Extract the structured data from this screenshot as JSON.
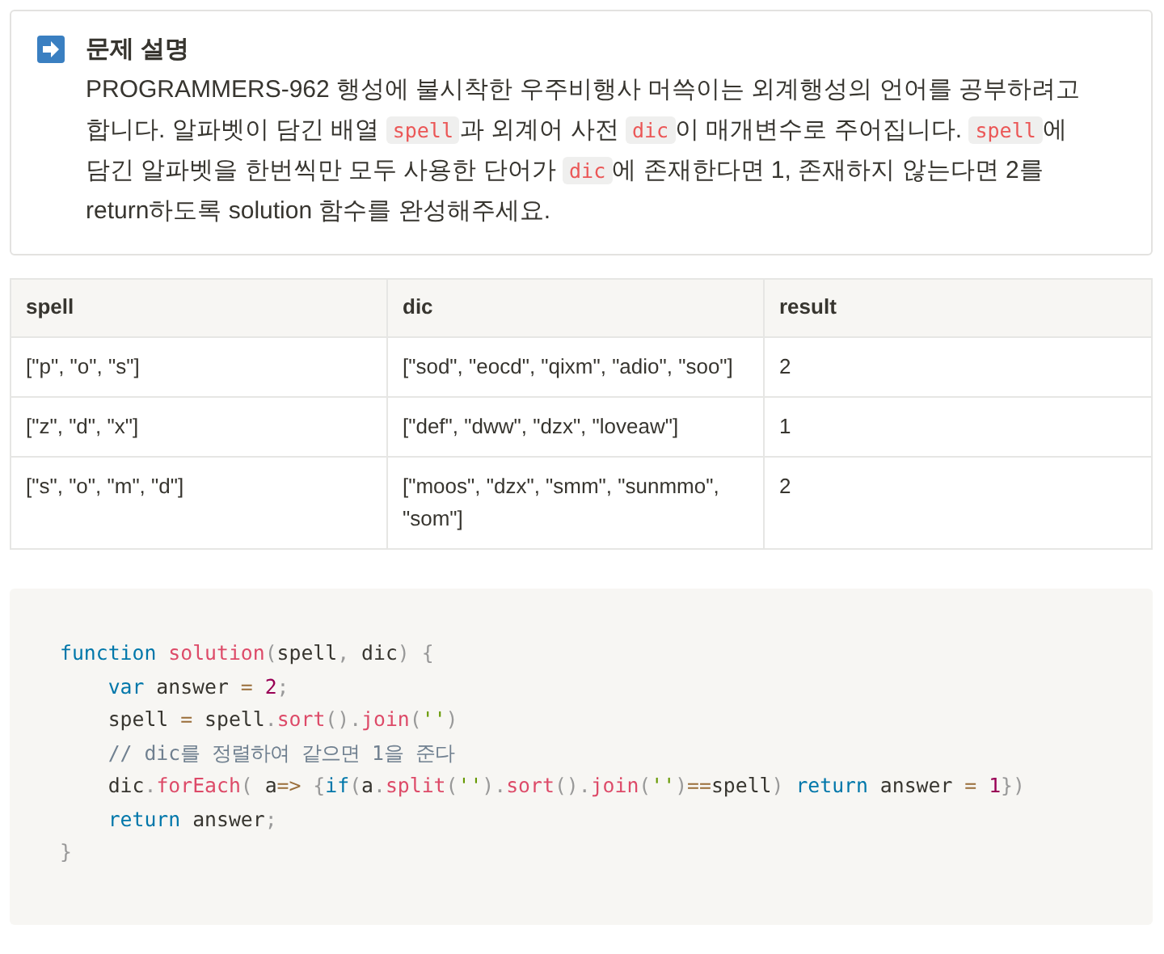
{
  "callout": {
    "title": "문제 설명",
    "paragraph": [
      {
        "kind": "text",
        "text": "PROGRAMMERS-962 행성에 불시착한 우주비행사 머쓱이는 외계행성의 언어를 공부하려고 합니다. 알파벳이 담긴 배열 "
      },
      {
        "kind": "code",
        "text": "spell"
      },
      {
        "kind": "text",
        "text": "과 외계어 사전 "
      },
      {
        "kind": "code",
        "text": "dic"
      },
      {
        "kind": "text",
        "text": "이 매개변수로 주어집니다. "
      },
      {
        "kind": "code",
        "text": "spell"
      },
      {
        "kind": "text",
        "text": "에 담긴 알파벳을 한번씩만 모두 사용한 단어가 "
      },
      {
        "kind": "code",
        "text": "dic"
      },
      {
        "kind": "text",
        "text": "에 존재한다면 1, 존재하지 않는다면 2를 return하도록 solution 함수를 완성해주세요."
      }
    ]
  },
  "table": {
    "columns": [
      "spell",
      "dic",
      "result"
    ],
    "rows": [
      [
        "[\"p\", \"o\", \"s\"]",
        "[\"sod\", \"eocd\", \"qixm\", \"adio\", \"soo\"]",
        "2"
      ],
      [
        "[\"z\", \"d\", \"x\"]",
        "[\"def\", \"dww\", \"dzx\", \"loveaw\"]",
        "1"
      ],
      [
        "[\"s\", \"o\", \"m\", \"d\"]",
        "[\"moos\", \"dzx\", \"smm\", \"sunmmo\", \"som\"]",
        "2"
      ]
    ]
  },
  "code": [
    [
      {
        "kind": "keyword",
        "text": "function"
      },
      {
        "kind": "function",
        "text": " solution"
      },
      {
        "kind": "punct",
        "text": "("
      },
      {
        "kind": "plain",
        "text": "spell"
      },
      {
        "kind": "punct",
        "text": ","
      },
      {
        "kind": "plain",
        "text": " dic"
      },
      {
        "kind": "punct",
        "text": ") {"
      }
    ],
    [
      {
        "kind": "keyword",
        "text": "    var"
      },
      {
        "kind": "plain",
        "text": " answer "
      },
      {
        "kind": "operator",
        "text": "="
      },
      {
        "kind": "number",
        "text": " 2"
      },
      {
        "kind": "punct",
        "text": ";"
      }
    ],
    [
      {
        "kind": "plain",
        "text": "    spell "
      },
      {
        "kind": "operator",
        "text": "="
      },
      {
        "kind": "plain",
        "text": " spell"
      },
      {
        "kind": "punct",
        "text": "."
      },
      {
        "kind": "function",
        "text": "sort"
      },
      {
        "kind": "punct",
        "text": "()."
      },
      {
        "kind": "function",
        "text": "join"
      },
      {
        "kind": "punct",
        "text": "("
      },
      {
        "kind": "string",
        "text": "''"
      },
      {
        "kind": "punct",
        "text": ")"
      }
    ],
    [
      {
        "kind": "comment",
        "text": "    // dic를 정렬하여 같으면 1을 준다"
      }
    ],
    [
      {
        "kind": "plain",
        "text": "    dic"
      },
      {
        "kind": "punct",
        "text": "."
      },
      {
        "kind": "function",
        "text": "forEach"
      },
      {
        "kind": "punct",
        "text": "("
      },
      {
        "kind": "plain",
        "text": " a"
      },
      {
        "kind": "operator",
        "text": "=>"
      },
      {
        "kind": "punct",
        "text": " {"
      },
      {
        "kind": "keyword",
        "text": "if"
      },
      {
        "kind": "punct",
        "text": "("
      },
      {
        "kind": "plain",
        "text": "a"
      },
      {
        "kind": "punct",
        "text": "."
      },
      {
        "kind": "function",
        "text": "split"
      },
      {
        "kind": "punct",
        "text": "("
      },
      {
        "kind": "string",
        "text": "''"
      },
      {
        "kind": "punct",
        "text": ")."
      },
      {
        "kind": "function",
        "text": "sort"
      },
      {
        "kind": "punct",
        "text": "()."
      },
      {
        "kind": "function",
        "text": "join"
      },
      {
        "kind": "punct",
        "text": "("
      },
      {
        "kind": "string",
        "text": "''"
      },
      {
        "kind": "punct",
        "text": ")"
      },
      {
        "kind": "operator",
        "text": "=="
      },
      {
        "kind": "plain",
        "text": "spell"
      },
      {
        "kind": "punct",
        "text": ")"
      },
      {
        "kind": "keyword",
        "text": " return"
      },
      {
        "kind": "plain",
        "text": " answer "
      },
      {
        "kind": "operator",
        "text": "="
      },
      {
        "kind": "number",
        "text": " 1"
      },
      {
        "kind": "punct",
        "text": "})"
      }
    ],
    [
      {
        "kind": "keyword",
        "text": "    return"
      },
      {
        "kind": "plain",
        "text": " answer"
      },
      {
        "kind": "punct",
        "text": ";"
      }
    ],
    [
      {
        "kind": "punct",
        "text": "}"
      }
    ]
  ]
}
